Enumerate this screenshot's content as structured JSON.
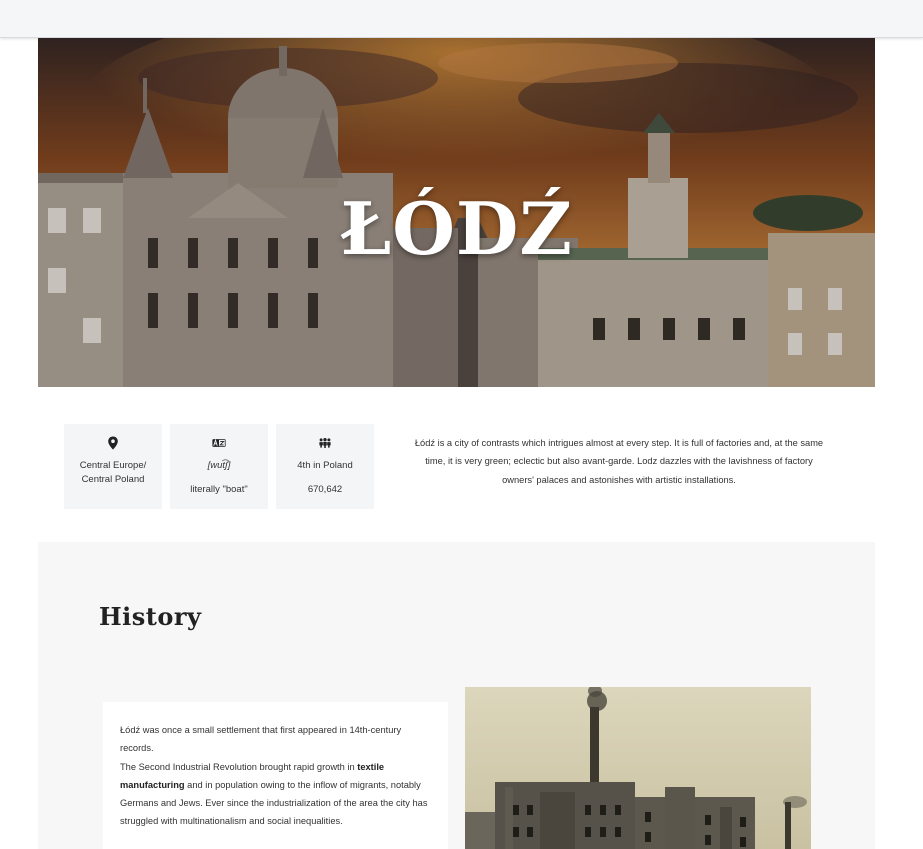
{
  "hero": {
    "title": "ŁÓDŹ"
  },
  "facts": [
    {
      "icon": "location-pin-icon",
      "lines": [
        "Central Europe/",
        "Central Poland"
      ]
    },
    {
      "icon": "translation-icon",
      "pronunciation": "[wut͡ʃ]",
      "meaning": "literally \"boat\""
    },
    {
      "icon": "people-icon",
      "rank": "4th in Poland",
      "population": "670,642"
    }
  ],
  "intro": {
    "text": "Łódź is a city of contrasts which intrigues almost at every step. It is full of factories and, at the same time, it is very green; eclectic but also avant-garde. Lodz dazzles with the lavishness of factory owners' palaces and astonishes with artistic installations."
  },
  "history": {
    "heading": "History",
    "p1": "Łódź was once a small settlement that first appeared in 14th-century records.",
    "p2_before": "The Second Industrial Revolution brought rapid growth in ",
    "p2_bold": "textile manufacturing",
    "p2_after": " and in population owing to the inflow of migrants, notably Germans and Jews. Ever since the industrialization of the area the city has struggled with multinationalism and social inequalities."
  },
  "colors": {
    "background": "#ffffff",
    "fact_card": "#f4f5f7",
    "history_section": "#f7f7f7",
    "text": "#333333"
  }
}
